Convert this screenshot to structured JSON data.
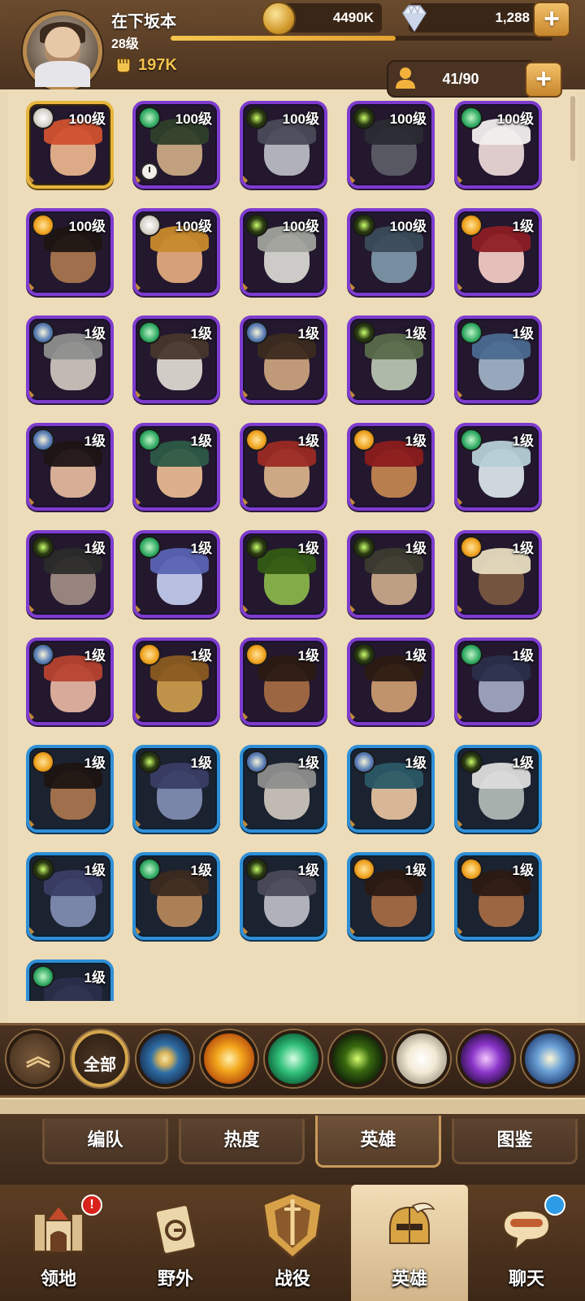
{
  "header": {
    "player_name": "在下坂本",
    "player_level": "28级",
    "xp_fraction": 0.59,
    "power": "197K",
    "gold": "4490K",
    "gems": "1,288"
  },
  "roster": {
    "capacity": "41/90",
    "heroes": [
      {
        "level": "100级",
        "faction": "light",
        "rarity": "gold",
        "skin": "#e8b28c",
        "hair": "#d1512f",
        "clock": false
      },
      {
        "level": "100级",
        "faction": "forest",
        "rarity": "purple",
        "skin": "#c9a883",
        "hair": "#2e3f2a",
        "clock": true
      },
      {
        "level": "100级",
        "faction": "grave",
        "rarity": "purple",
        "skin": "#b9b9c4",
        "hair": "#4a4a57",
        "clock": false
      },
      {
        "level": "100级",
        "faction": "grave",
        "rarity": "purple",
        "skin": "#5c5c66",
        "hair": "#2b2b33",
        "clock": false
      },
      {
        "level": "100级",
        "faction": "forest",
        "rarity": "purple",
        "skin": "#e9d6d6",
        "hair": "#f2eeee",
        "clock": false
      },
      {
        "level": "100级",
        "faction": "mauler",
        "rarity": "purple",
        "skin": "#a8744d",
        "hair": "#1e1512",
        "clock": false
      },
      {
        "level": "100级",
        "faction": "light",
        "rarity": "purple",
        "skin": "#e0a97c",
        "hair": "#c88a2c",
        "clock": false
      },
      {
        "level": "100级",
        "faction": "grave",
        "rarity": "purple",
        "skin": "#d6d5d0",
        "hair": "#a0a29c",
        "clock": false
      },
      {
        "level": "100级",
        "faction": "grave",
        "rarity": "purple",
        "skin": "#7c94a6",
        "hair": "#3b4b5a",
        "clock": false
      },
      {
        "level": "1级",
        "faction": "mauler",
        "rarity": "purple",
        "skin": "#f0c9c2",
        "hair": "#8d1d24",
        "clock": false
      },
      {
        "level": "1级",
        "faction": "lightbearer",
        "rarity": "purple",
        "skin": "#c9c3bb",
        "hair": "#8e8e8e",
        "clock": false
      },
      {
        "level": "1级",
        "faction": "forest",
        "rarity": "purple",
        "skin": "#dcd6cf",
        "hair": "#48362c",
        "clock": false
      },
      {
        "level": "1级",
        "faction": "lightbearer",
        "rarity": "purple",
        "skin": "#c9a07c",
        "hair": "#3c2a1f",
        "clock": false
      },
      {
        "level": "1级",
        "faction": "grave",
        "rarity": "purple",
        "skin": "#b7c2b0",
        "hair": "#5a6a4a",
        "clock": false
      },
      {
        "level": "1级",
        "faction": "forest",
        "rarity": "purple",
        "skin": "#9fb0c4",
        "hair": "#4b6a90",
        "clock": false
      },
      {
        "level": "1级",
        "faction": "lightbearer",
        "rarity": "purple",
        "skin": "#e2b79c",
        "hair": "#1d1414",
        "clock": false
      },
      {
        "level": "1级",
        "faction": "forest",
        "rarity": "purple",
        "skin": "#e7b88f",
        "hair": "#2d5a46",
        "clock": false
      },
      {
        "level": "1级",
        "faction": "mauler",
        "rarity": "purple",
        "skin": "#d7b08a",
        "hair": "#9b2a23",
        "clock": false
      },
      {
        "level": "1级",
        "faction": "mauler",
        "rarity": "purple",
        "skin": "#c1844f",
        "hair": "#8b1c1c",
        "clock": false
      },
      {
        "level": "1级",
        "faction": "forest",
        "rarity": "purple",
        "skin": "#d7e1e6",
        "hair": "#b7cfd6",
        "clock": false
      },
      {
        "level": "1级",
        "faction": "grave",
        "rarity": "purple",
        "skin": "#9e8a83",
        "hair": "#2b2b2b",
        "clock": false
      },
      {
        "level": "1级",
        "faction": "forest",
        "rarity": "purple",
        "skin": "#c1c8ea",
        "hair": "#5a63b2",
        "clock": false
      },
      {
        "level": "1级",
        "faction": "grave",
        "rarity": "purple",
        "skin": "#89b34a",
        "hair": "#345a14",
        "clock": false
      },
      {
        "level": "1级",
        "faction": "grave",
        "rarity": "purple",
        "skin": "#c7a789",
        "hair": "#3b3b2f",
        "clock": false
      },
      {
        "level": "1级",
        "faction": "mauler",
        "rarity": "purple",
        "skin": "#7a5740",
        "hair": "#e7dcc0",
        "clock": false
      },
      {
        "level": "1级",
        "faction": "lightbearer",
        "rarity": "purple",
        "skin": "#e3b2a0",
        "hair": "#b7422f",
        "clock": false
      },
      {
        "level": "1级",
        "faction": "mauler",
        "rarity": "purple",
        "skin": "#c89a4b",
        "hair": "#8a5a20",
        "clock": false
      },
      {
        "level": "1级",
        "faction": "mauler",
        "rarity": "purple",
        "skin": "#a36a44",
        "hair": "#2b1a12",
        "clock": false
      },
      {
        "level": "1级",
        "faction": "grave",
        "rarity": "purple",
        "skin": "#c99a70",
        "hair": "#2b1a12",
        "clock": false
      },
      {
        "level": "1级",
        "faction": "forest",
        "rarity": "purple",
        "skin": "#9fa5c0",
        "hair": "#2b2e4a",
        "clock": false
      },
      {
        "level": "1级",
        "faction": "mauler",
        "rarity": "blue",
        "skin": "#a8744d",
        "hair": "#1e1512",
        "clock": false
      },
      {
        "level": "1级",
        "faction": "grave",
        "rarity": "blue",
        "skin": "#7e8bb0",
        "hair": "#3a3e66",
        "clock": false
      },
      {
        "level": "1级",
        "faction": "lightbearer",
        "rarity": "blue",
        "skin": "#c9c3bb",
        "hair": "#8e8e8e",
        "clock": false
      },
      {
        "level": "1级",
        "faction": "lightbearer",
        "rarity": "blue",
        "skin": "#e2c09c",
        "hair": "#2b5a66",
        "clock": false
      },
      {
        "level": "1级",
        "faction": "grave",
        "rarity": "blue",
        "skin": "#b0b8b5",
        "hair": "#dcdcdc",
        "clock": false
      },
      {
        "level": "1级",
        "faction": "grave",
        "rarity": "blue",
        "skin": "#7e8bb0",
        "hair": "#3a3e66",
        "clock": false
      },
      {
        "level": "1级",
        "faction": "forest",
        "rarity": "blue",
        "skin": "#b3865a",
        "hair": "#3b2a1f",
        "clock": false
      },
      {
        "level": "1级",
        "faction": "grave",
        "rarity": "blue",
        "skin": "#b9b9c4",
        "hair": "#4a4a57",
        "clock": false
      },
      {
        "level": "1级",
        "faction": "mauler",
        "rarity": "blue",
        "skin": "#a36a44",
        "hair": "#2b1a12",
        "clock": false
      },
      {
        "level": "1级",
        "faction": "mauler",
        "rarity": "blue",
        "skin": "#a36a44",
        "hair": "#2b1a12",
        "clock": false
      },
      {
        "level": "1级",
        "faction": "forest",
        "rarity": "blue",
        "skin": "#9fa5c0",
        "hair": "#2b2e4a",
        "clock": false
      }
    ]
  },
  "filters": {
    "all_label": "全部",
    "items": [
      "collapse",
      "all",
      "lightbearer",
      "mauler",
      "wilder",
      "graveborn",
      "celestial",
      "hypogean",
      "dimensional"
    ]
  },
  "subtabs": [
    {
      "label": "编队",
      "active": false
    },
    {
      "label": "热度",
      "active": false
    },
    {
      "label": "英雄",
      "active": true
    },
    {
      "label": "图鉴",
      "active": false
    }
  ],
  "nav": [
    {
      "label": "领地",
      "icon": "castle-icon",
      "badge": "!",
      "active": false
    },
    {
      "label": "野外",
      "icon": "map-scroll-icon",
      "badge": "",
      "active": false
    },
    {
      "label": "战役",
      "icon": "battle-shield-icon",
      "badge": "",
      "active": false
    },
    {
      "label": "英雄",
      "icon": "hero-helmet-icon",
      "badge": "",
      "active": true
    },
    {
      "label": "聊天",
      "icon": "chat-bubble-icon",
      "badge": "dot",
      "active": false
    }
  ],
  "colors": {
    "gold_frame": "#e7b53d",
    "purple_frame": "#7e3ccf",
    "blue_frame": "#2f8fd6",
    "badge_red": "#d9221b"
  }
}
